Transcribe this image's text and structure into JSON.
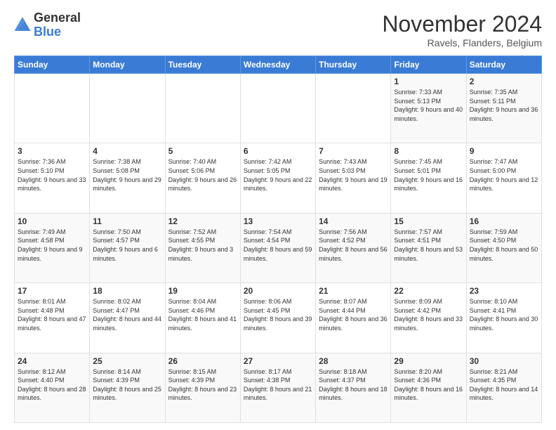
{
  "logo": {
    "general": "General",
    "blue": "Blue"
  },
  "header": {
    "month": "November 2024",
    "location": "Ravels, Flanders, Belgium"
  },
  "weekdays": [
    "Sunday",
    "Monday",
    "Tuesday",
    "Wednesday",
    "Thursday",
    "Friday",
    "Saturday"
  ],
  "weeks": [
    [
      {
        "day": "",
        "sunrise": "",
        "sunset": "",
        "daylight": ""
      },
      {
        "day": "",
        "sunrise": "",
        "sunset": "",
        "daylight": ""
      },
      {
        "day": "",
        "sunrise": "",
        "sunset": "",
        "daylight": ""
      },
      {
        "day": "",
        "sunrise": "",
        "sunset": "",
        "daylight": ""
      },
      {
        "day": "",
        "sunrise": "",
        "sunset": "",
        "daylight": ""
      },
      {
        "day": "1",
        "sunrise": "Sunrise: 7:33 AM",
        "sunset": "Sunset: 5:13 PM",
        "daylight": "Daylight: 9 hours and 40 minutes."
      },
      {
        "day": "2",
        "sunrise": "Sunrise: 7:35 AM",
        "sunset": "Sunset: 5:11 PM",
        "daylight": "Daylight: 9 hours and 36 minutes."
      }
    ],
    [
      {
        "day": "3",
        "sunrise": "Sunrise: 7:36 AM",
        "sunset": "Sunset: 5:10 PM",
        "daylight": "Daylight: 9 hours and 33 minutes."
      },
      {
        "day": "4",
        "sunrise": "Sunrise: 7:38 AM",
        "sunset": "Sunset: 5:08 PM",
        "daylight": "Daylight: 9 hours and 29 minutes."
      },
      {
        "day": "5",
        "sunrise": "Sunrise: 7:40 AM",
        "sunset": "Sunset: 5:06 PM",
        "daylight": "Daylight: 9 hours and 26 minutes."
      },
      {
        "day": "6",
        "sunrise": "Sunrise: 7:42 AM",
        "sunset": "Sunset: 5:05 PM",
        "daylight": "Daylight: 9 hours and 22 minutes."
      },
      {
        "day": "7",
        "sunrise": "Sunrise: 7:43 AM",
        "sunset": "Sunset: 5:03 PM",
        "daylight": "Daylight: 9 hours and 19 minutes."
      },
      {
        "day": "8",
        "sunrise": "Sunrise: 7:45 AM",
        "sunset": "Sunset: 5:01 PM",
        "daylight": "Daylight: 9 hours and 16 minutes."
      },
      {
        "day": "9",
        "sunrise": "Sunrise: 7:47 AM",
        "sunset": "Sunset: 5:00 PM",
        "daylight": "Daylight: 9 hours and 12 minutes."
      }
    ],
    [
      {
        "day": "10",
        "sunrise": "Sunrise: 7:49 AM",
        "sunset": "Sunset: 4:58 PM",
        "daylight": "Daylight: 9 hours and 9 minutes."
      },
      {
        "day": "11",
        "sunrise": "Sunrise: 7:50 AM",
        "sunset": "Sunset: 4:57 PM",
        "daylight": "Daylight: 9 hours and 6 minutes."
      },
      {
        "day": "12",
        "sunrise": "Sunrise: 7:52 AM",
        "sunset": "Sunset: 4:55 PM",
        "daylight": "Daylight: 9 hours and 3 minutes."
      },
      {
        "day": "13",
        "sunrise": "Sunrise: 7:54 AM",
        "sunset": "Sunset: 4:54 PM",
        "daylight": "Daylight: 8 hours and 59 minutes."
      },
      {
        "day": "14",
        "sunrise": "Sunrise: 7:56 AM",
        "sunset": "Sunset: 4:52 PM",
        "daylight": "Daylight: 8 hours and 56 minutes."
      },
      {
        "day": "15",
        "sunrise": "Sunrise: 7:57 AM",
        "sunset": "Sunset: 4:51 PM",
        "daylight": "Daylight: 8 hours and 53 minutes."
      },
      {
        "day": "16",
        "sunrise": "Sunrise: 7:59 AM",
        "sunset": "Sunset: 4:50 PM",
        "daylight": "Daylight: 8 hours and 50 minutes."
      }
    ],
    [
      {
        "day": "17",
        "sunrise": "Sunrise: 8:01 AM",
        "sunset": "Sunset: 4:48 PM",
        "daylight": "Daylight: 8 hours and 47 minutes."
      },
      {
        "day": "18",
        "sunrise": "Sunrise: 8:02 AM",
        "sunset": "Sunset: 4:47 PM",
        "daylight": "Daylight: 8 hours and 44 minutes."
      },
      {
        "day": "19",
        "sunrise": "Sunrise: 8:04 AM",
        "sunset": "Sunset: 4:46 PM",
        "daylight": "Daylight: 8 hours and 41 minutes."
      },
      {
        "day": "20",
        "sunrise": "Sunrise: 8:06 AM",
        "sunset": "Sunset: 4:45 PM",
        "daylight": "Daylight: 8 hours and 39 minutes."
      },
      {
        "day": "21",
        "sunrise": "Sunrise: 8:07 AM",
        "sunset": "Sunset: 4:44 PM",
        "daylight": "Daylight: 8 hours and 36 minutes."
      },
      {
        "day": "22",
        "sunrise": "Sunrise: 8:09 AM",
        "sunset": "Sunset: 4:42 PM",
        "daylight": "Daylight: 8 hours and 33 minutes."
      },
      {
        "day": "23",
        "sunrise": "Sunrise: 8:10 AM",
        "sunset": "Sunset: 4:41 PM",
        "daylight": "Daylight: 8 hours and 30 minutes."
      }
    ],
    [
      {
        "day": "24",
        "sunrise": "Sunrise: 8:12 AM",
        "sunset": "Sunset: 4:40 PM",
        "daylight": "Daylight: 8 hours and 28 minutes."
      },
      {
        "day": "25",
        "sunrise": "Sunrise: 8:14 AM",
        "sunset": "Sunset: 4:39 PM",
        "daylight": "Daylight: 8 hours and 25 minutes."
      },
      {
        "day": "26",
        "sunrise": "Sunrise: 8:15 AM",
        "sunset": "Sunset: 4:39 PM",
        "daylight": "Daylight: 8 hours and 23 minutes."
      },
      {
        "day": "27",
        "sunrise": "Sunrise: 8:17 AM",
        "sunset": "Sunset: 4:38 PM",
        "daylight": "Daylight: 8 hours and 21 minutes."
      },
      {
        "day": "28",
        "sunrise": "Sunrise: 8:18 AM",
        "sunset": "Sunset: 4:37 PM",
        "daylight": "Daylight: 8 hours and 18 minutes."
      },
      {
        "day": "29",
        "sunrise": "Sunrise: 8:20 AM",
        "sunset": "Sunset: 4:36 PM",
        "daylight": "Daylight: 8 hours and 16 minutes."
      },
      {
        "day": "30",
        "sunrise": "Sunrise: 8:21 AM",
        "sunset": "Sunset: 4:35 PM",
        "daylight": "Daylight: 8 hours and 14 minutes."
      }
    ]
  ]
}
